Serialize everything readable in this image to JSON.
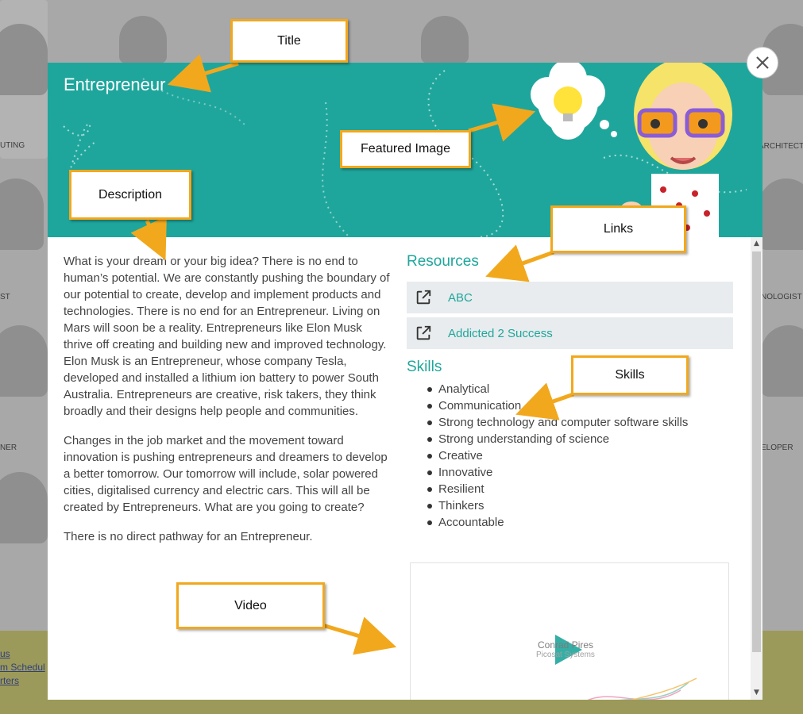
{
  "background": {
    "tile_labels": [
      "UTING",
      "ARCHITECT",
      "ST",
      "NOLOGIST",
      "NER",
      "ELOPER"
    ],
    "footer_links": [
      "us",
      "m Schedul",
      "rters"
    ]
  },
  "modal": {
    "title": "Entrepreneur",
    "close_label": "×",
    "description": [
      "What is your dream or your big idea? There is no end to human’s potential. We are constantly pushing the boundary of our potential to create, develop and implement products and technologies. There is no end for an Entrepreneur. Living on Mars will soon be a reality. Entrepreneurs like Elon Musk thrive off creating and building new and improved technology. Elon Musk is an Entrepreneur, whose company Tesla, developed and installed a lithium ion battery to power South Australia. Entrepreneurs are creative, risk takers, they think broadly and their designs help people and communities.",
      "Changes in the job market and the movement toward innovation is pushing entrepreneurs and dreamers to develop a better tomorrow. Our tomorrow will include, solar powered cities, digitalised currency and electric cars. This will all be created by Entrepreneurs. What are you going to create?",
      "There is no direct pathway for an Entrepreneur."
    ],
    "resources_title": "Resources",
    "resources": [
      {
        "label": "ABC",
        "icon": "external-link-icon"
      },
      {
        "label": "Addicted 2 Success",
        "icon": "external-link-icon"
      }
    ],
    "skills_title": "Skills",
    "skills": [
      "Analytical",
      "Communication",
      "Strong technology and computer software skills",
      "Strong understanding of science",
      "Creative",
      "Innovative",
      "Resilient",
      "Thinkers",
      "Accountable"
    ],
    "video": {
      "name": "Conrad Pires",
      "company": "Picosat Systems"
    },
    "colors": {
      "accent": "#1fa69c",
      "callout_border": "#f2a81d"
    }
  },
  "annotations": {
    "title": "Title",
    "featured_image": "Featured Image",
    "description": "Description",
    "links": "Links",
    "skills": "Skills",
    "video": "Video"
  }
}
